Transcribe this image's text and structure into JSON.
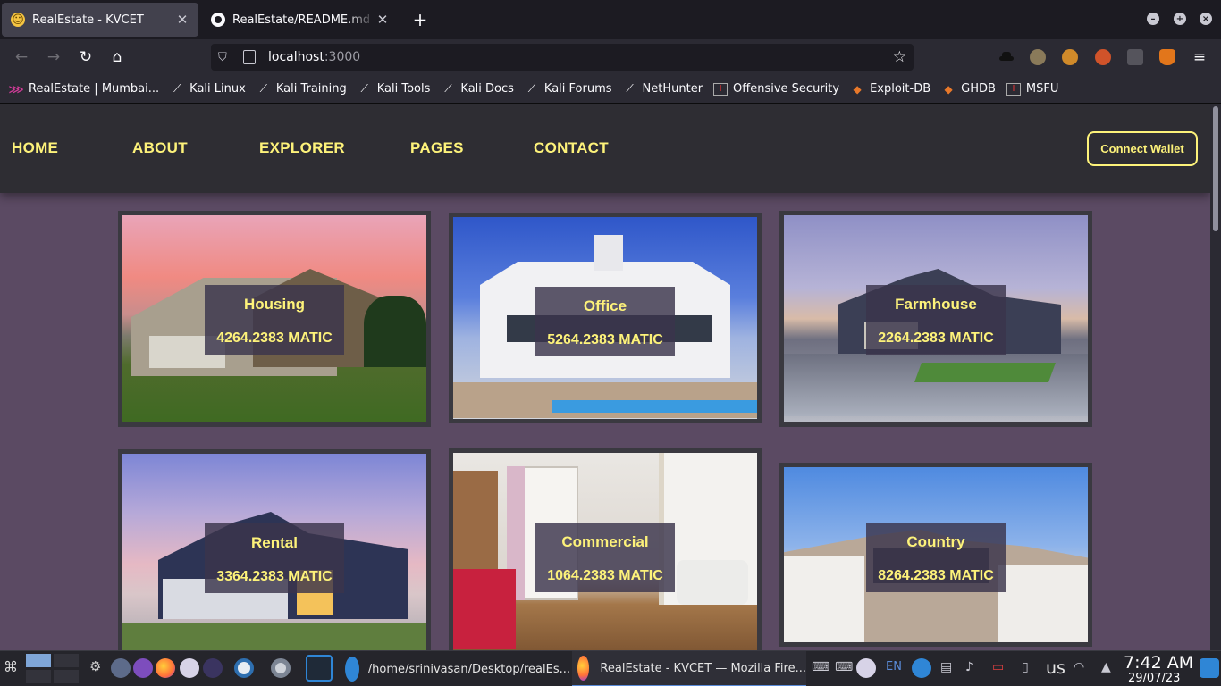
{
  "browser": {
    "tabs": [
      {
        "title": "RealEstate - KVCET",
        "icon": "smiley-favicon"
      },
      {
        "title": "RealEstate/README.md at",
        "icon": "github-icon"
      }
    ],
    "new_tab": "+",
    "url_host": "localhost",
    "url_port": ":3000",
    "bookmarks": [
      {
        "label": "RealEstate | Mumbai...",
        "icon": "logo-icon"
      },
      {
        "label": "Kali Linux",
        "icon": "kali-dragon-icon"
      },
      {
        "label": "Kali Training",
        "icon": "kali-dragon-icon"
      },
      {
        "label": "Kali Tools",
        "icon": "kali-dragon-icon"
      },
      {
        "label": "Kali Docs",
        "icon": "kali-dragon-icon"
      },
      {
        "label": "Kali Forums",
        "icon": "kali-dragon-icon"
      },
      {
        "label": "NetHunter",
        "icon": "kali-dragon-icon"
      },
      {
        "label": "Offensive Security",
        "icon": "offsec-icon"
      },
      {
        "label": "Exploit-DB",
        "icon": "exploit-db-icon"
      },
      {
        "label": "GHDB",
        "icon": "exploit-db-icon"
      },
      {
        "label": "MSFU",
        "icon": "offsec-icon"
      }
    ]
  },
  "site": {
    "nav": [
      {
        "label": "HOME"
      },
      {
        "label": "ABOUT"
      },
      {
        "label": "EXPLORER"
      },
      {
        "label": "PAGES"
      },
      {
        "label": "CONTACT"
      }
    ],
    "wallet_button": "Connect Wallet",
    "colors": {
      "accent": "#fdf27a",
      "page_bg": "#5b4a63",
      "nav_bg": "#2e2d33"
    },
    "listings": [
      {
        "name": "Housing",
        "price": "4264.2383 MATIC"
      },
      {
        "name": "Office",
        "price": "5264.2383 MATIC"
      },
      {
        "name": "Farmhouse",
        "price": "2264.2383 MATIC"
      },
      {
        "name": "Rental",
        "price": "3364.2383 MATIC"
      },
      {
        "name": "Commercial",
        "price": "1064.2383 MATIC"
      },
      {
        "name": "Country",
        "price": "8264.2383 MATIC"
      }
    ]
  },
  "taskbar": {
    "tasks": [
      {
        "label": "/home/srinivasan/Desktop/realEs..."
      },
      {
        "label": "RealEstate - KVCET — Mozilla Fire..."
      }
    ],
    "lang": "EN",
    "layout": "us",
    "time": "7:42 AM",
    "date": "29/07/23"
  }
}
